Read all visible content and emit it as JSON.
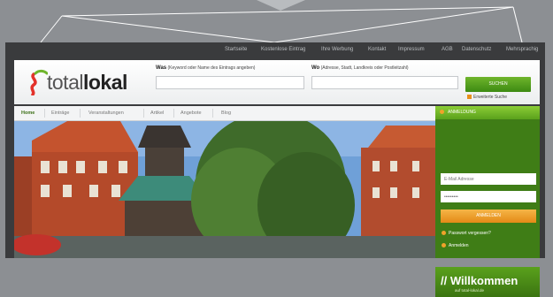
{
  "top_nav": {
    "items": [
      "Startseite",
      "Kostenlose Eintrag",
      "Ihre Werbung",
      "Kontakt",
      "Impressum",
      "AGB",
      "Datenschutz",
      "Mehrsprachig"
    ]
  },
  "header": {
    "logo": {
      "light": "total",
      "bold": "lokal"
    },
    "search": {
      "what_label_bold": "Was",
      "what_label_hint": "(Keyword oder Name des Eintrags angeben)",
      "where_label_bold": "Wo",
      "where_label_hint": "(Adresse, Stadt, Landkreis oder Postleitzahl)",
      "what_value": "",
      "where_value": "",
      "search_button": "SUCHEN",
      "advanced_link": "Erweiterte Suche"
    }
  },
  "tabs": {
    "items": [
      "Home",
      "Einträge",
      "Veranstaltungen",
      "Artikel",
      "Angebote",
      "Blog"
    ],
    "active_index": 0
  },
  "sidebar": {
    "heading": "ANMELDUNG",
    "email_placeholder": "E-Mail Adresse",
    "password_value": "•••••••••",
    "login_button": "ANMELDEN",
    "forgot_link": "Passwort vergessen?",
    "register_link": "Anmelden",
    "welcome_title": "// Willkommen",
    "welcome_url": "auf total-lokal.de"
  },
  "colors": {
    "brand_green": "#5aa11c",
    "accent_orange": "#e88f1b",
    "frame_dark": "#3a3b3d"
  }
}
